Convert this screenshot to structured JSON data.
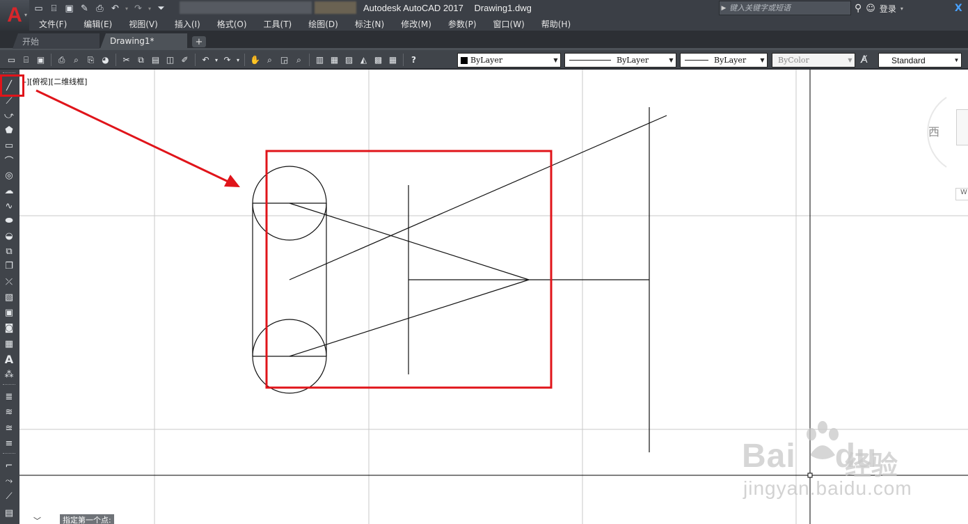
{
  "app": {
    "logo_letter": "A",
    "title_app": "Autodesk AutoCAD 2017",
    "title_file": "Drawing1.dwg",
    "search_placeholder": "键入关键字或短语",
    "login_label": "登录"
  },
  "menu": [
    "文件(F)",
    "编辑(E)",
    "视图(V)",
    "插入(I)",
    "格式(O)",
    "工具(T)",
    "绘图(D)",
    "标注(N)",
    "修改(M)",
    "参数(P)",
    "窗口(W)",
    "帮助(H)"
  ],
  "tabs": [
    {
      "label": "开始"
    },
    {
      "label": "Drawing1*"
    }
  ],
  "properties": {
    "color": "ByLayer",
    "linetype": "ByLayer",
    "lineweight": "ByLayer",
    "plotstyle": "ByColor",
    "textstyle": "Standard"
  },
  "viewport_label": "-][俯视][二维线框]",
  "viewcube_letter": "西",
  "wcs_label": "W",
  "command_prompt": "指定第一个点:",
  "watermark": {
    "bai": "Bai",
    "du": "du",
    "jingyan": "经验",
    "url": "jingyan.baidu.com"
  },
  "colors": {
    "highlight": "#e0141a",
    "chrome_dark": "#3b3f46",
    "logo_red": "#d7262b"
  }
}
